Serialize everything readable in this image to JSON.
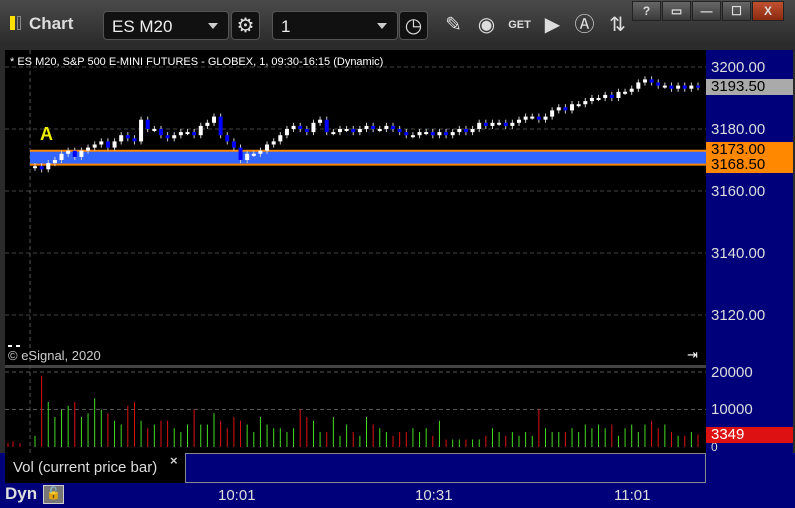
{
  "window": {
    "title": "Chart",
    "help": "?",
    "minimize": "—",
    "maximize": "☐",
    "close": "X"
  },
  "toolbar": {
    "symbol": "ES M20",
    "interval": "1"
  },
  "chart": {
    "header": "* ES M20, S&P 500 E-MINI FUTURES - GLOBEX, 1, 09:30-16:15 (Dynamic)",
    "watermark": "© eSignal, 2020",
    "marker": "A",
    "last_price": "3193.50",
    "band_high": "3173.00",
    "band_low": "3168.50",
    "colors": {
      "up": "#ffffff",
      "down": "#0000ff",
      "band": "#3366ff",
      "band_edge": "#ff8800",
      "vol_up": "#44dd22",
      "vol_down": "#dd1111"
    }
  },
  "volume": {
    "legend": "Vol (current price bar)",
    "close_label": "×",
    "current": "3349",
    "ticks": [
      "20000",
      "10000",
      "0"
    ]
  },
  "bottom": {
    "mode": "Dyn"
  },
  "chart_data": {
    "type": "candlestick",
    "price_ticks": [
      "3200.00",
      "3180.00",
      "3160.00",
      "3140.00",
      "3120.00"
    ],
    "ylim": [
      3105,
      3216
    ],
    "time_ticks": [
      "10:01",
      "10:31",
      "11:01"
    ],
    "early": [
      3110,
      3110
    ],
    "closes": [
      3168,
      3167,
      3169,
      3170,
      3172,
      3173,
      3171,
      3173,
      3174,
      3175,
      3176,
      3174,
      3176,
      3178,
      3177,
      3176,
      3183,
      3180,
      3180,
      3178,
      3177,
      3178,
      3179,
      3179,
      3178,
      3181,
      3182,
      3184,
      3178,
      3176,
      3174,
      3170,
      3172,
      3172,
      3173,
      3175,
      3176,
      3178,
      3180,
      3181,
      3180,
      3179,
      3182,
      3183,
      3179,
      3179,
      3180,
      3180,
      3179,
      3180,
      3181,
      3180,
      3180,
      3181,
      3180,
      3179,
      3178,
      3178,
      3179,
      3179,
      3178,
      3179,
      3178,
      3179,
      3180,
      3179,
      3180,
      3182,
      3181,
      3182,
      3182,
      3181,
      3182,
      3183,
      3184,
      3184,
      3183,
      3184,
      3186,
      3187,
      3186,
      3188,
      3188,
      3189,
      3190,
      3190,
      3191,
      3190,
      3192,
      3192,
      3193,
      3195,
      3196,
      3195,
      3194,
      3194,
      3193,
      3194,
      3193,
      3194,
      3193.5
    ],
    "volumes": [
      3,
      19,
      12,
      8,
      10,
      11,
      12,
      8,
      9,
      13,
      10,
      9,
      7,
      6,
      11,
      12,
      7,
      5,
      6,
      7,
      7,
      5,
      4,
      6,
      10,
      6,
      6,
      9,
      7,
      5,
      8,
      7,
      6,
      4,
      8,
      6,
      5,
      5,
      4,
      5,
      10,
      8,
      7,
      4,
      4,
      8,
      3,
      6,
      4,
      3,
      8,
      6,
      5,
      4,
      3,
      4,
      4,
      5,
      4,
      5,
      3,
      7,
      2,
      2,
      2,
      2,
      2,
      2,
      3,
      5,
      4,
      3,
      4,
      3,
      4,
      3,
      10,
      5,
      4,
      4,
      4,
      5,
      4,
      6,
      5,
      6,
      5,
      6,
      3,
      5,
      6,
      4,
      6,
      7,
      5,
      6,
      4,
      3,
      3,
      4,
      3.35
    ]
  }
}
